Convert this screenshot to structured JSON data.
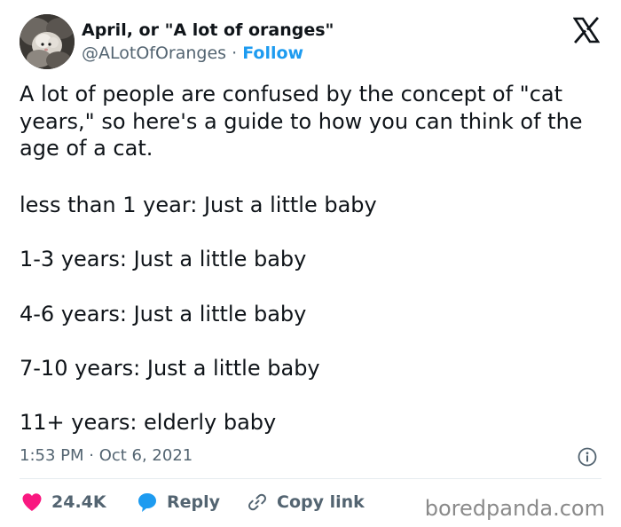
{
  "author": {
    "display_name": "April, or \"A lot of oranges\"",
    "handle": "@ALotOfOranges",
    "separator": "·",
    "follow_label": "Follow"
  },
  "brand_icon": "x-logo-icon",
  "tweet": {
    "intro": "A lot of people are confused by the concept of \"cat years,\" so here's a guide to how you can think of the age of a cat.",
    "lines": [
      "less than 1 year: Just a little baby",
      "1-3 years: Just a little baby",
      "4-6 years: Just a little baby",
      "7-10 years: Just a little baby",
      "11+ years: elderly baby"
    ],
    "timestamp": "1:53 PM · Oct 6, 2021"
  },
  "actions": {
    "like_count": "24.4K",
    "reply_label": "Reply",
    "copy_label": "Copy link"
  },
  "watermark": "boredpanda.com",
  "colors": {
    "accent": "#1d9bf0",
    "like": "#f91880",
    "text": "#0f1419",
    "muted": "#536471"
  }
}
